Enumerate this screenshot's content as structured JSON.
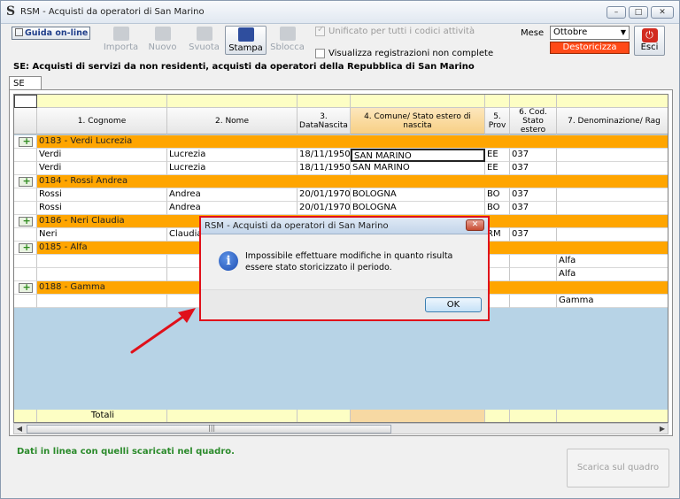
{
  "window": {
    "title": "RSM - Acquisti da operatori di San Marino",
    "controls": [
      "–",
      "□",
      "✕"
    ]
  },
  "toolbar": {
    "guida_label": "Guida on-line",
    "buttons": [
      {
        "label": "Importa",
        "icon": "import-icon",
        "enabled": false
      },
      {
        "label": "Nuovo",
        "icon": "new-icon",
        "enabled": false
      },
      {
        "label": "Svuota",
        "icon": "clear-icon",
        "enabled": false
      },
      {
        "label": "Stampa",
        "icon": "printer-icon",
        "enabled": true
      },
      {
        "label": "Sblocca",
        "icon": "unlock-icon",
        "enabled": false
      }
    ],
    "checkbox_unificato": "Unificato per tutti i codici attività",
    "checkbox_visualizza": "Visualizza registrazioni non complete",
    "mese_label": "Mese",
    "mese_value": "Ottobre",
    "destoricizza_label": "Destoricizza",
    "esci_label": "Esci"
  },
  "section_title": "SE: Acquisti di servizi da non residenti, acquisti da operatori della Repubblica di San Marino",
  "tab_label": "SE",
  "grid": {
    "columns": [
      "1. Cognome",
      "2. Nome",
      "3. DataNascita",
      "4. Comune/ Stato estero di nascita",
      "5. Prov",
      "6. Cod. Stato estero",
      "7. Denominazione/ Rag"
    ],
    "rows": [
      {
        "type": "group",
        "label": "0183 - Verdi Lucrezia"
      },
      {
        "type": "data",
        "cells": [
          "Verdi",
          "Lucrezia",
          "18/11/1950",
          "SAN MARINO",
          "EE",
          "037",
          ""
        ],
        "selected_col": 3
      },
      {
        "type": "data",
        "cells": [
          "Verdi",
          "Lucrezia",
          "18/11/1950",
          "SAN MARINO",
          "EE",
          "037",
          ""
        ]
      },
      {
        "type": "group",
        "label": "0184 - Rossi Andrea"
      },
      {
        "type": "data",
        "cells": [
          "Rossi",
          "Andrea",
          "20/01/1970",
          "BOLOGNA",
          "BO",
          "037",
          ""
        ]
      },
      {
        "type": "data",
        "cells": [
          "Rossi",
          "Andrea",
          "20/01/1970",
          "BOLOGNA",
          "BO",
          "037",
          ""
        ]
      },
      {
        "type": "group",
        "label": "0186 - Neri Claudia"
      },
      {
        "type": "data",
        "cells": [
          "Neri",
          "Claudia",
          "",
          "",
          "RM",
          "037",
          ""
        ]
      },
      {
        "type": "group",
        "label": "0185 - Alfa"
      },
      {
        "type": "data",
        "cells": [
          "",
          "",
          "",
          "",
          "",
          "",
          "Alfa"
        ]
      },
      {
        "type": "data",
        "cells": [
          "",
          "",
          "",
          "",
          "",
          "",
          "Alfa"
        ]
      },
      {
        "type": "group",
        "label": "0188 - Gamma"
      },
      {
        "type": "data",
        "cells": [
          "",
          "",
          "",
          "",
          "",
          "",
          "Gamma"
        ]
      }
    ],
    "totals_label": "Totali"
  },
  "status_text": "Dati in linea con quelli scaricati nel quadro.",
  "scarica_label": "Scarica sul quadro",
  "dialog": {
    "title": "RSM - Acquisti da operatori di San Marino",
    "message": "Impossibile effettuare modifiche in quanto risulta essere stato storicizzato il periodo.",
    "ok_label": "OK"
  },
  "colors": {
    "group_row": "#ffa500",
    "filter_row": "#fdfec4",
    "grid_empty": "#b7d3e6",
    "destoricizza": "#ff4a18",
    "dialog_border": "#e0101a",
    "status_text": "#2a8a2a"
  }
}
